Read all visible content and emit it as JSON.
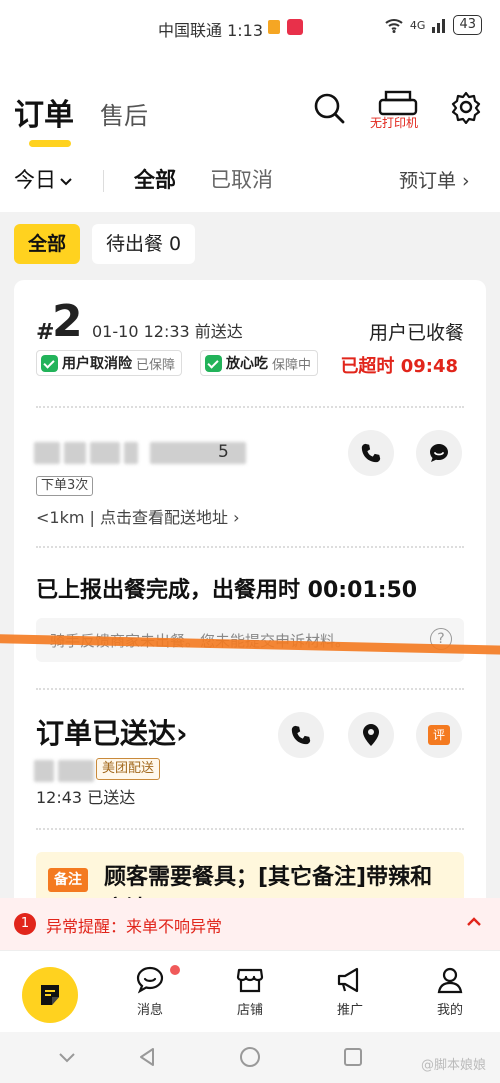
{
  "status_bar": {
    "carrier_time": "中国联通 1:13",
    "battery": "43",
    "net": "4G"
  },
  "header": {
    "tab_orders": "订单",
    "tab_aftersale": "售后",
    "printer_label": "无打印机"
  },
  "filters": {
    "today": "今日",
    "all": "全部",
    "cancelled": "已取消",
    "preorder": "预订单 ›"
  },
  "chips": [
    {
      "label": "全部"
    },
    {
      "label": "待出餐 0"
    }
  ],
  "order": {
    "hash": "#",
    "number": "2",
    "deliver_time": "01-10 12:33 前送达",
    "status": "用户已收餐",
    "badge1_title": "用户取消险",
    "badge1_sub": "已保障",
    "badge2_title": "放心吃",
    "badge2_sub": "保障中",
    "overtime": "已超时 09:48",
    "customer_suffix": "5",
    "order_count_tag": "下单3次",
    "distance": "<1km | 点击查看配送地址 ›",
    "report": "已上报出餐完成，出餐用时 00:01:50",
    "rider_note": "骑手反馈商家未出餐。您未能提交申诉材料。",
    "help": "?",
    "delivered_title": "订单已送达›",
    "delivery_tag": "美团配送",
    "delivered_time": "12:43  已送达",
    "review_icon": "评",
    "remark_tag": "备注",
    "remark_text": "顾客需要餐具；[其它备注]带辣和麻油"
  },
  "alert": {
    "count": "1",
    "text": "异常提醒：来单不响异常"
  },
  "tabbar": [
    {
      "label": "消息"
    },
    {
      "label": "店铺"
    },
    {
      "label": "推广"
    },
    {
      "label": "我的"
    }
  ],
  "watermark": "@脚本娘娘",
  "colors": {
    "brand_yellow": "#ffd21f",
    "alert_red": "#e1251b",
    "accent_orange": "#f47a20"
  }
}
